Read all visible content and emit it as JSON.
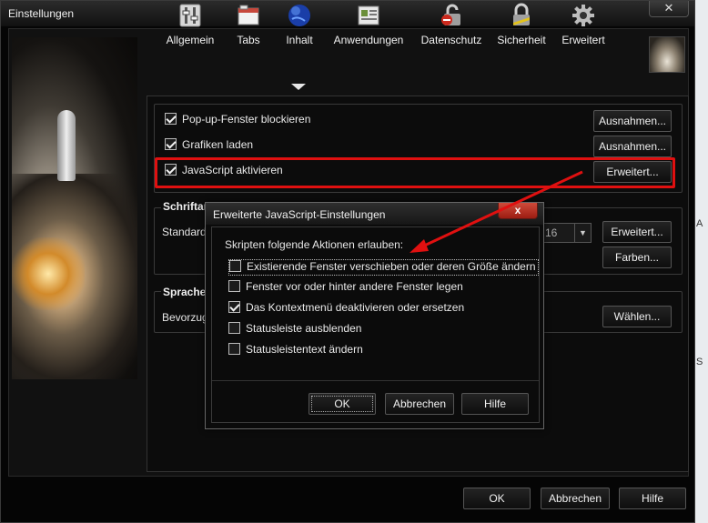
{
  "window": {
    "title": "Einstellungen",
    "close_glyph": "✕"
  },
  "toolbar": {
    "items": [
      {
        "label": "Allgemein",
        "icon": "general-switches-icon"
      },
      {
        "label": "Tabs",
        "icon": "tabs-icon"
      },
      {
        "label": "Inhalt",
        "icon": "content-globe-icon"
      },
      {
        "label": "Anwendungen",
        "icon": "applications-icon"
      },
      {
        "label": "Datenschutz",
        "icon": "privacy-icon"
      },
      {
        "label": "Sicherheit",
        "icon": "security-lock-icon"
      },
      {
        "label": "Erweitert",
        "icon": "advanced-gear-icon"
      }
    ],
    "active": "Inhalt"
  },
  "content": {
    "checkboxes": [
      {
        "label": "Pop-up-Fenster blockieren",
        "checked": true,
        "button": "Ausnahmen..."
      },
      {
        "label": "Grafiken laden",
        "checked": true,
        "button": "Ausnahmen..."
      },
      {
        "label": "JavaScript aktivieren",
        "checked": true,
        "button": "Erweitert..."
      }
    ],
    "fonts_group": {
      "label": "Schriftar",
      "default_label": "Standard",
      "size_value": "16",
      "advanced_button": "Erweitert...",
      "colors_button": "Farben..."
    },
    "languages_group": {
      "label": "Sprache",
      "preferred_label": "Bevorzug",
      "choose_button": "Wählen..."
    }
  },
  "dialog": {
    "title": "Erweiterte JavaScript-Einstellungen",
    "close_glyph": "x",
    "prompt": "Skripten folgende Aktionen erlauben:",
    "options": [
      {
        "label": "Existierende Fenster verschieben oder deren Größe ändern",
        "checked": false
      },
      {
        "label": "Fenster vor oder hinter andere Fenster legen",
        "checked": false
      },
      {
        "label": "Das Kontextmenü deaktivieren oder ersetzen",
        "checked": true
      },
      {
        "label": "Statusleiste ausblenden",
        "checked": false
      },
      {
        "label": "Statusleistentext ändern",
        "checked": false
      }
    ],
    "ok": "OK",
    "cancel": "Abbrechen",
    "help": "Hilfe"
  },
  "footer": {
    "ok": "OK",
    "cancel": "Abbrechen",
    "help": "Hilfe"
  },
  "desktop_edge": {
    "chars": [
      "A",
      "S"
    ]
  },
  "colors": {
    "highlight": "#e01010",
    "background": "#050505"
  }
}
